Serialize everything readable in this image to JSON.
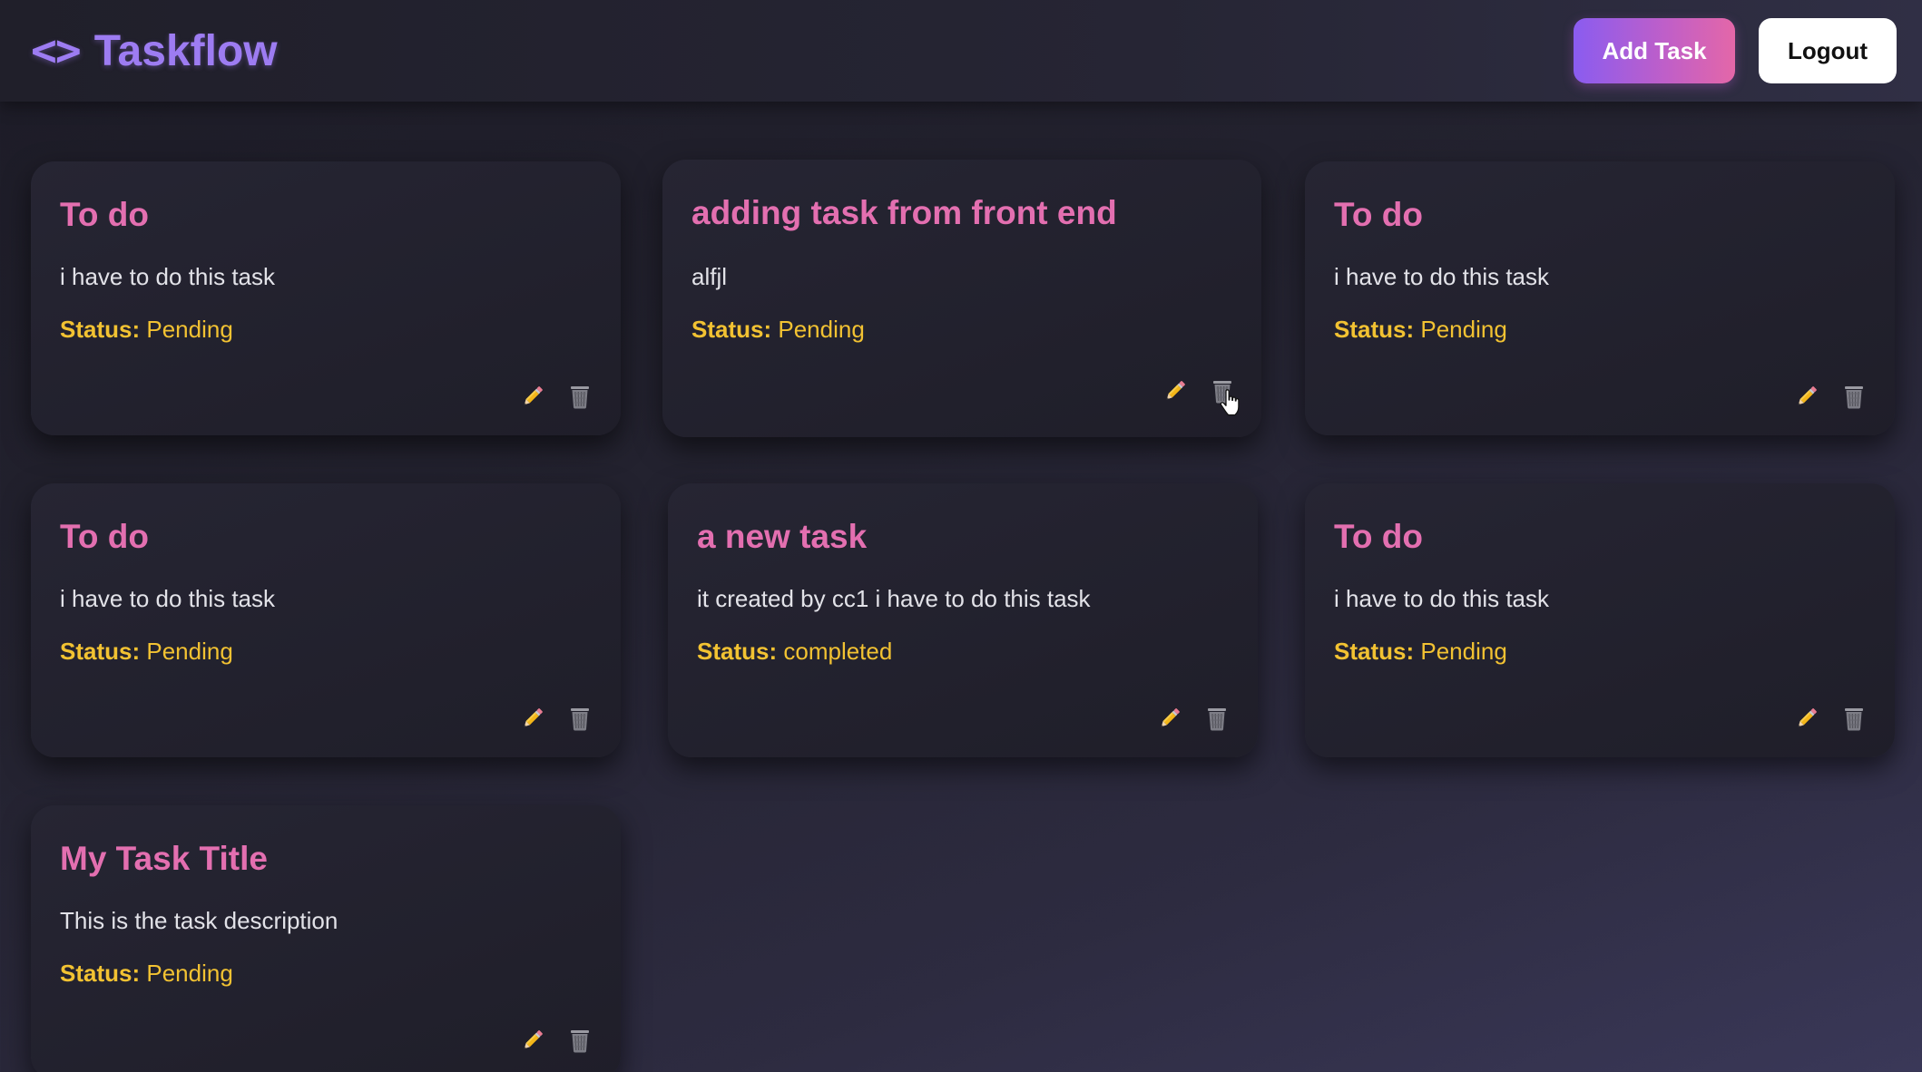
{
  "navbar": {
    "brand_icon": "<>",
    "brand_name": "Taskflow",
    "add_task_label": "Add Task",
    "logout_label": "Logout"
  },
  "status_label": "Status:",
  "tasks": [
    {
      "title": "To do",
      "description": "i have to do this task",
      "status": "Pending"
    },
    {
      "title": "adding task from front end",
      "description": "alfjl",
      "status": "Pending"
    },
    {
      "title": "To do",
      "description": "i have to do this task",
      "status": "Pending"
    },
    {
      "title": "To do",
      "description": "i have to do this task",
      "status": "Pending"
    },
    {
      "title": "a new task",
      "description": "it created by cc1 i have to do this task",
      "status": "completed"
    },
    {
      "title": "To do",
      "description": "i have to do this task",
      "status": "Pending"
    },
    {
      "title": "My Task Title",
      "description": "This is the task description",
      "status": "Pending"
    }
  ],
  "icons": {
    "edit": "pencil-icon",
    "delete": "trash-icon"
  },
  "colors": {
    "brand": "#9d7cf2",
    "title": "#e36fb0",
    "status": "#f2c232",
    "add_button_gradient": [
      "#8a5cf0",
      "#e467a8"
    ]
  }
}
